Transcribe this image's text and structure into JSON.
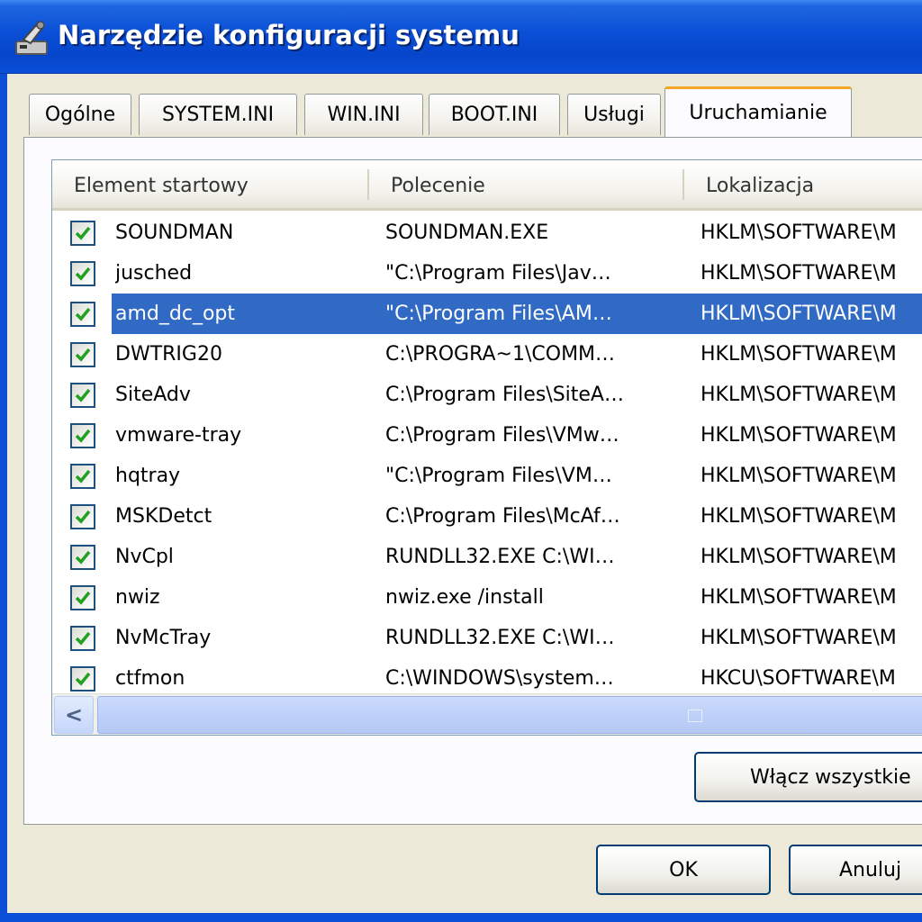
{
  "window": {
    "title": "Narzędzie konfiguracji systemu",
    "icon": "config-tool-icon"
  },
  "tabs": [
    {
      "label": "Ogólne"
    },
    {
      "label": "SYSTEM.INI"
    },
    {
      "label": "WIN.INI"
    },
    {
      "label": "BOOT.INI"
    },
    {
      "label": "Usługi"
    },
    {
      "label": "Uruchamianie",
      "active": true
    }
  ],
  "list": {
    "columns": [
      "Element startowy",
      "Polecenie",
      "Lokalizacja"
    ],
    "rows": [
      {
        "checked": true,
        "name": "SOUNDMAN",
        "command": "SOUNDMAN.EXE",
        "location": "HKLM\\SOFTWARE\\M"
      },
      {
        "checked": true,
        "name": "jusched",
        "command": "\"C:\\Program Files\\Jav…",
        "location": "HKLM\\SOFTWARE\\M"
      },
      {
        "checked": true,
        "name": "amd_dc_opt",
        "command": "\"C:\\Program Files\\AM…",
        "location": "HKLM\\SOFTWARE\\M",
        "selected": true
      },
      {
        "checked": true,
        "name": "DWTRIG20",
        "command": "C:\\PROGRA~1\\COMM…",
        "location": "HKLM\\SOFTWARE\\M"
      },
      {
        "checked": true,
        "name": "SiteAdv",
        "command": "C:\\Program Files\\SiteA…",
        "location": "HKLM\\SOFTWARE\\M"
      },
      {
        "checked": true,
        "name": "vmware-tray",
        "command": "C:\\Program Files\\VMw…",
        "location": "HKLM\\SOFTWARE\\M"
      },
      {
        "checked": true,
        "name": "hqtray",
        "command": "\"C:\\Program Files\\VM…",
        "location": "HKLM\\SOFTWARE\\M"
      },
      {
        "checked": true,
        "name": "MSKDetct",
        "command": "C:\\Program Files\\McAf…",
        "location": "HKLM\\SOFTWARE\\M"
      },
      {
        "checked": true,
        "name": "NvCpl",
        "command": "RUNDLL32.EXE C:\\WI…",
        "location": "HKLM\\SOFTWARE\\M"
      },
      {
        "checked": true,
        "name": "nwiz",
        "command": "nwiz.exe /install",
        "location": "HKLM\\SOFTWARE\\M"
      },
      {
        "checked": true,
        "name": "NvMcTray",
        "command": "RUNDLL32.EXE C:\\WI…",
        "location": "HKLM\\SOFTWARE\\M"
      },
      {
        "checked": true,
        "name": "ctfmon",
        "command": "C:\\WINDOWS\\system…",
        "location": "HKCU\\SOFTWARE\\M"
      }
    ]
  },
  "scrollbar": {
    "left_arrow": "<"
  },
  "buttons": {
    "enable_all": "Włącz wszystkie",
    "ok": "OK",
    "cancel": "Anuluj"
  },
  "colors": {
    "titlebar": "#0a4fd6",
    "selection": "#316ac5",
    "active_tab_accent": "#f5a623",
    "checkmark": "#21a121"
  }
}
